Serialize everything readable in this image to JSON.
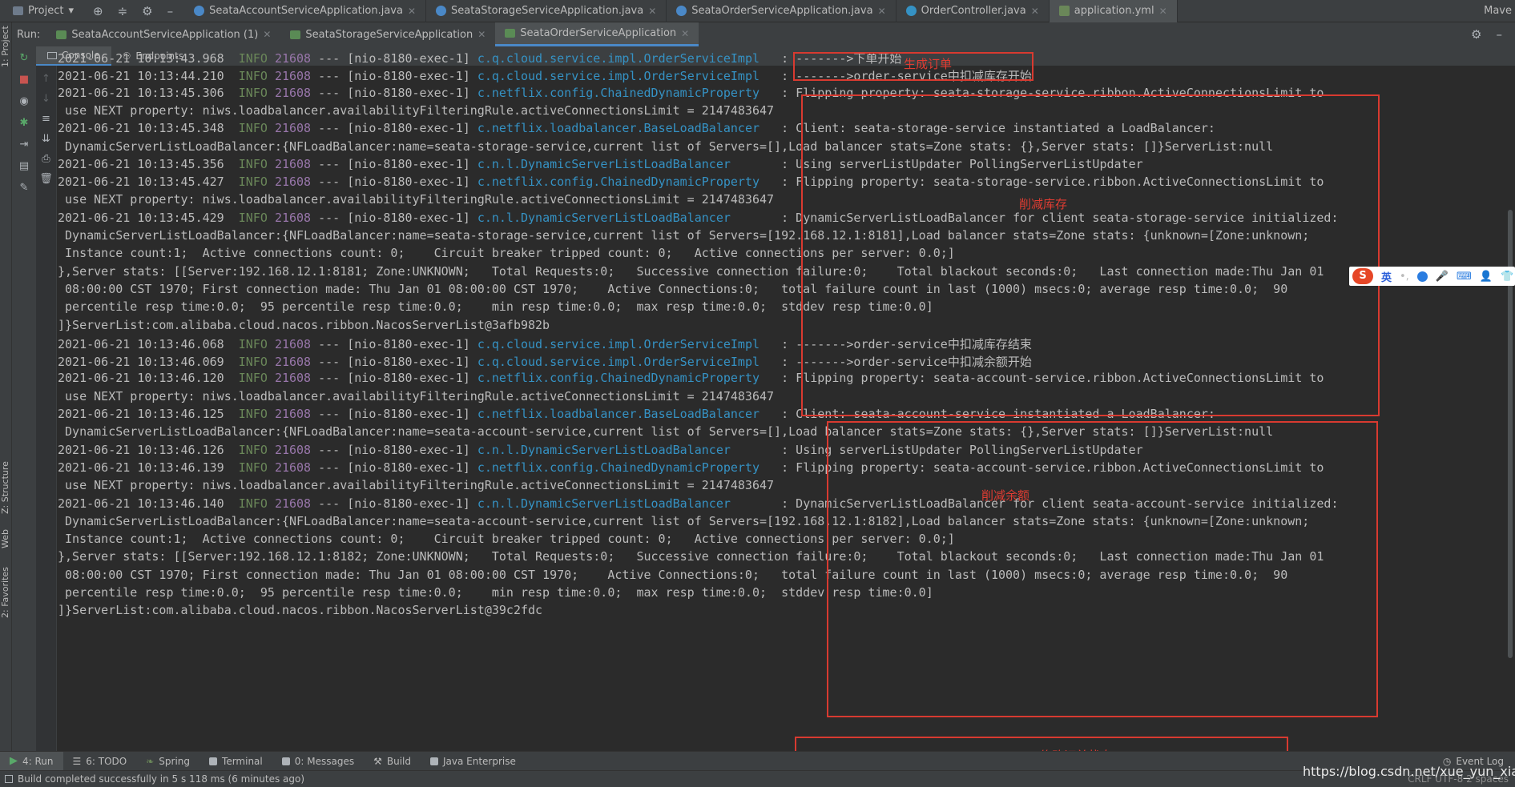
{
  "topbar": {
    "project_label": "Project",
    "tabs": [
      {
        "label": "SeataAccountServiceApplication.java",
        "kind": "class"
      },
      {
        "label": "SeataStorageServiceApplication.java",
        "kind": "class"
      },
      {
        "label": "SeataOrderServiceApplication.java",
        "kind": "class"
      },
      {
        "label": "OrderController.java",
        "kind": "controller"
      },
      {
        "label": "application.yml",
        "kind": "yml"
      }
    ],
    "right_label": "Mave"
  },
  "left_stripe": {
    "project": "1: Project",
    "structure": "Z: Structure",
    "web": "Web",
    "favorites": "2: Favorites"
  },
  "runbar": {
    "run_label": "Run:",
    "tabs": [
      {
        "label": "SeataAccountServiceApplication (1)"
      },
      {
        "label": "SeataStorageServiceApplication"
      },
      {
        "label": "SeataOrderServiceApplication"
      }
    ]
  },
  "console_tabs": [
    "Console",
    "Endpoints"
  ],
  "log_lines": [
    {
      "pre": "2021-06-21 10:13:43.968  ",
      "lvl": "INFO",
      "pid": "21608",
      "mid": " --- [nio-8180-exec-1] ",
      "logger": "c.q.cloud.service.impl.OrderServiceImpl ",
      "msg": "  : ------->下单开始"
    },
    {
      "pre": "2021-06-21 10:13:44.210  ",
      "lvl": "INFO",
      "pid": "21608",
      "mid": " --- [nio-8180-exec-1] ",
      "logger": "c.q.cloud.service.impl.OrderServiceImpl ",
      "msg": "  : ------->order-service中扣减库存开始"
    },
    {
      "pre": "2021-06-21 10:13:45.306  ",
      "lvl": "INFO",
      "pid": "21608",
      "mid": " --- [nio-8180-exec-1] ",
      "logger": "c.netflix.config.ChainedDynamicProperty ",
      "msg": "  : Flipping property: seata-storage-service.ribbon.ActiveConnectionsLimit to"
    },
    {
      "pre": " use NEXT property: niws.loadbalancer.availabilityFilteringRule.activeConnectionsLimit = 2147483647"
    },
    {
      "pre": "2021-06-21 10:13:45.348  ",
      "lvl": "INFO",
      "pid": "21608",
      "mid": " --- [nio-8180-exec-1] ",
      "logger": "c.netflix.loadbalancer.BaseLoadBalancer ",
      "msg": "  : Client: seata-storage-service instantiated a LoadBalancer:"
    },
    {
      "pre": " DynamicServerListLoadBalancer:{NFLoadBalancer:name=seata-storage-service,current list of Servers=[],Load balancer stats=Zone stats: {},Server stats: []}ServerList:null"
    },
    {
      "pre": "2021-06-21 10:13:45.356  ",
      "lvl": "INFO",
      "pid": "21608",
      "mid": " --- [nio-8180-exec-1] ",
      "logger": "c.n.l.DynamicServerListLoadBalancer     ",
      "msg": "  : Using serverListUpdater PollingServerListUpdater"
    },
    {
      "pre": "2021-06-21 10:13:45.427  ",
      "lvl": "INFO",
      "pid": "21608",
      "mid": " --- [nio-8180-exec-1] ",
      "logger": "c.netflix.config.ChainedDynamicProperty ",
      "msg": "  : Flipping property: seata-storage-service.ribbon.ActiveConnectionsLimit to"
    },
    {
      "pre": " use NEXT property: niws.loadbalancer.availabilityFilteringRule.activeConnectionsLimit = 2147483647"
    },
    {
      "pre": "2021-06-21 10:13:45.429  ",
      "lvl": "INFO",
      "pid": "21608",
      "mid": " --- [nio-8180-exec-1] ",
      "logger": "c.n.l.DynamicServerListLoadBalancer     ",
      "msg": "  : DynamicServerListLoadBalancer for client seata-storage-service initialized:"
    },
    {
      "pre": " DynamicServerListLoadBalancer:{NFLoadBalancer:name=seata-storage-service,current list of Servers=[192.168.12.1:8181],Load balancer stats=Zone stats: {unknown=[Zone:unknown;"
    },
    {
      "pre": " Instance count:1;  Active connections count: 0;    Circuit breaker tripped count: 0;   Active connections per server: 0.0;]"
    },
    {
      "pre": "},Server stats: [[Server:192.168.12.1:8181; Zone:UNKNOWN;   Total Requests:0;   Successive connection failure:0;    Total blackout seconds:0;   Last connection made:Thu Jan 01"
    },
    {
      "pre": " 08:00:00 CST 1970; First connection made: Thu Jan 01 08:00:00 CST 1970;    Active Connections:0;   total failure count in last (1000) msecs:0; average resp time:0.0;  90"
    },
    {
      "pre": " percentile resp time:0.0;  95 percentile resp time:0.0;    min resp time:0.0;  max resp time:0.0;  stddev resp time:0.0]"
    },
    {
      "pre": "]}ServerList:com.alibaba.cloud.nacos.ribbon.NacosServerList@3afb982b"
    },
    {
      "pre": "2021-06-21 10:13:46.068  ",
      "lvl": "INFO",
      "pid": "21608",
      "mid": " --- [nio-8180-exec-1] ",
      "logger": "c.q.cloud.service.impl.OrderServiceImpl ",
      "msg": "  : ------->order-service中扣减库存结束"
    },
    {
      "pre": "2021-06-21 10:13:46.069  ",
      "lvl": "INFO",
      "pid": "21608",
      "mid": " --- [nio-8180-exec-1] ",
      "logger": "c.q.cloud.service.impl.OrderServiceImpl ",
      "msg": "  : ------->order-service中扣减余额开始"
    },
    {
      "pre": "2021-06-21 10:13:46.120  ",
      "lvl": "INFO",
      "pid": "21608",
      "mid": " --- [nio-8180-exec-1] ",
      "logger": "c.netflix.config.ChainedDynamicProperty ",
      "msg": "  : Flipping property: seata-account-service.ribbon.ActiveConnectionsLimit to"
    },
    {
      "pre": " use NEXT property: niws.loadbalancer.availabilityFilteringRule.activeConnectionsLimit = 2147483647"
    },
    {
      "pre": "2021-06-21 10:13:46.125  ",
      "lvl": "INFO",
      "pid": "21608",
      "mid": " --- [nio-8180-exec-1] ",
      "logger": "c.netflix.loadbalancer.BaseLoadBalancer ",
      "msg": "  : Client: seata-account-service instantiated a LoadBalancer:"
    },
    {
      "pre": " DynamicServerListLoadBalancer:{NFLoadBalancer:name=seata-account-service,current list of Servers=[],Load balancer stats=Zone stats: {},Server stats: []}ServerList:null"
    },
    {
      "pre": "2021-06-21 10:13:46.126  ",
      "lvl": "INFO",
      "pid": "21608",
      "mid": " --- [nio-8180-exec-1] ",
      "logger": "c.n.l.DynamicServerListLoadBalancer     ",
      "msg": "  : Using serverListUpdater PollingServerListUpdater"
    },
    {
      "pre": "2021-06-21 10:13:46.139  ",
      "lvl": "INFO",
      "pid": "21608",
      "mid": " --- [nio-8180-exec-1] ",
      "logger": "c.netflix.config.ChainedDynamicProperty ",
      "msg": "  : Flipping property: seata-account-service.ribbon.ActiveConnectionsLimit to"
    },
    {
      "pre": " use NEXT property: niws.loadbalancer.availabilityFilteringRule.activeConnectionsLimit = 2147483647"
    },
    {
      "pre": "2021-06-21 10:13:46.140  ",
      "lvl": "INFO",
      "pid": "21608",
      "mid": " --- [nio-8180-exec-1] ",
      "logger": "c.n.l.DynamicServerListLoadBalancer     ",
      "msg": "  : DynamicServerListLoadBalancer for client seata-account-service initialized:"
    },
    {
      "pre": " DynamicServerListLoadBalancer:{NFLoadBalancer:name=seata-account-service,current list of Servers=[192.168.12.1:8182],Load balancer stats=Zone stats: {unknown=[Zone:unknown;"
    },
    {
      "pre": " Instance count:1;  Active connections count: 0;    Circuit breaker tripped count: 0;   Active connections per server: 0.0;]"
    },
    {
      "pre": "},Server stats: [[Server:192.168.12.1:8182; Zone:UNKNOWN;   Total Requests:0;   Successive connection failure:0;    Total blackout seconds:0;   Last connection made:Thu Jan 01"
    },
    {
      "pre": " 08:00:00 CST 1970; First connection made: Thu Jan 01 08:00:00 CST 1970;    Active Connections:0;   total failure count in last (1000) msecs:0; average resp time:0.0;  90"
    },
    {
      "pre": " percentile resp time:0.0;  95 percentile resp time:0.0;    min resp time:0.0;  max resp time:0.0;  stddev resp time:0.0]"
    },
    {
      "pre": "]}ServerList:com.alibaba.cloud.nacos.ribbon.NacosServerList@39c2fdc"
    }
  ],
  "annotations": [
    {
      "label": "生成订单"
    },
    {
      "label": "削减库存"
    },
    {
      "label": "削减余额"
    },
    {
      "label": "修改订单状态"
    }
  ],
  "bottom_tabs": [
    {
      "label": "4: Run"
    },
    {
      "label": "6: TODO"
    },
    {
      "label": "Spring"
    },
    {
      "label": "Terminal"
    },
    {
      "label": "0: Messages"
    },
    {
      "label": "Build"
    },
    {
      "label": "Java Enterprise"
    }
  ],
  "event_log": "Event Log",
  "status": {
    "message": "Build completed successfully in 5 s 118 ms (6 minutes ago)",
    "right": "CRLF  UTF-8  2 spaces"
  },
  "watermark": "https://blog.csdn.net/xue_yun_xiang",
  "ime": {
    "logo": "S",
    "mode": "英"
  },
  "colors": {
    "annotation": "#d83a30",
    "logger": "#3592c4",
    "info": "#6a8759",
    "pid": "#9876aa"
  }
}
